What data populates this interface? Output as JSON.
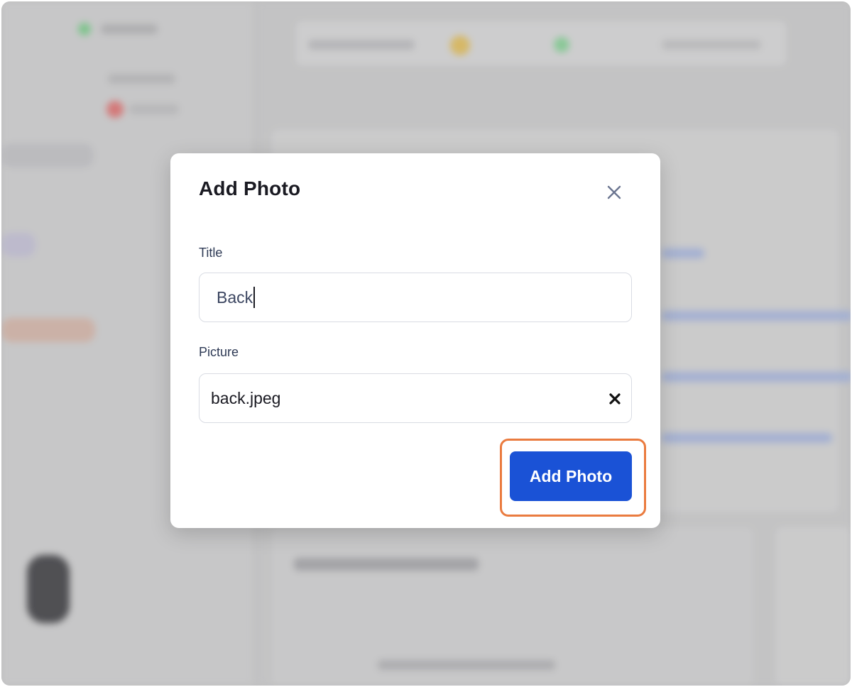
{
  "dialog": {
    "title": "Add Photo",
    "close_icon": "close-icon",
    "fields": {
      "title_label": "Title",
      "title_value": "Back",
      "picture_label": "Picture",
      "picture_value": "back.jpeg"
    },
    "submit_label": "Add Photo"
  },
  "colors": {
    "primary": "#1a52d6",
    "focus_ring": "#ea7b3f",
    "backdrop": "#c9c9ca"
  }
}
